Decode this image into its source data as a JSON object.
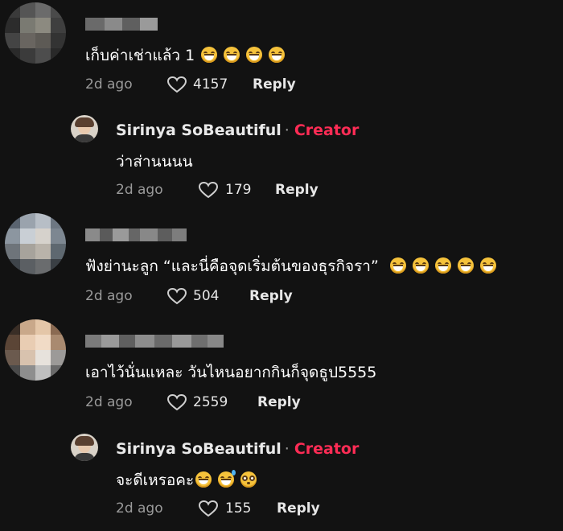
{
  "comments": [
    {
      "author": "",
      "text": "เก็บค่าเช่าแล้ว 1",
      "emojis": [
        "laugh-tears",
        "laugh-tears",
        "laugh-tears",
        "laugh-tears"
      ],
      "time": "2d ago",
      "likes": "4157",
      "reply_label": "Reply"
    },
    {
      "author": "Sirinya SoBeautiful",
      "separator": "·",
      "badge": "Creator",
      "text": "ว่าส่านนนน",
      "emojis": [],
      "time": "2d ago",
      "likes": "179",
      "reply_label": "Reply"
    },
    {
      "author": "",
      "text": "ฟังย่านะลูก “และนี่คือจุดเริ่มต้นของธุรกิจรา”",
      "emojis": [
        "laugh-tears",
        "laugh-tears",
        "laugh-tears",
        "laugh-tears",
        "laugh-tears"
      ],
      "time": "2d ago",
      "likes": "504",
      "reply_label": "Reply"
    },
    {
      "author": "",
      "text": "เอาไว้นั่นแหละ วันไหนอยากกินก็จุดธูป5555",
      "emojis": [],
      "time": "2d ago",
      "likes": "2559",
      "reply_label": "Reply"
    },
    {
      "author": "Sirinya SoBeautiful",
      "separator": "·",
      "badge": "Creator",
      "text": "จะดีเหรอคะ",
      "emojis": [
        "grin",
        "sweat-smile",
        "flushed"
      ],
      "time": "2d ago",
      "likes": "155",
      "reply_label": "Reply"
    }
  ],
  "colors": {
    "background": "#121212",
    "creator_badge": "#fe2c55",
    "muted": "#9a9a9a"
  }
}
